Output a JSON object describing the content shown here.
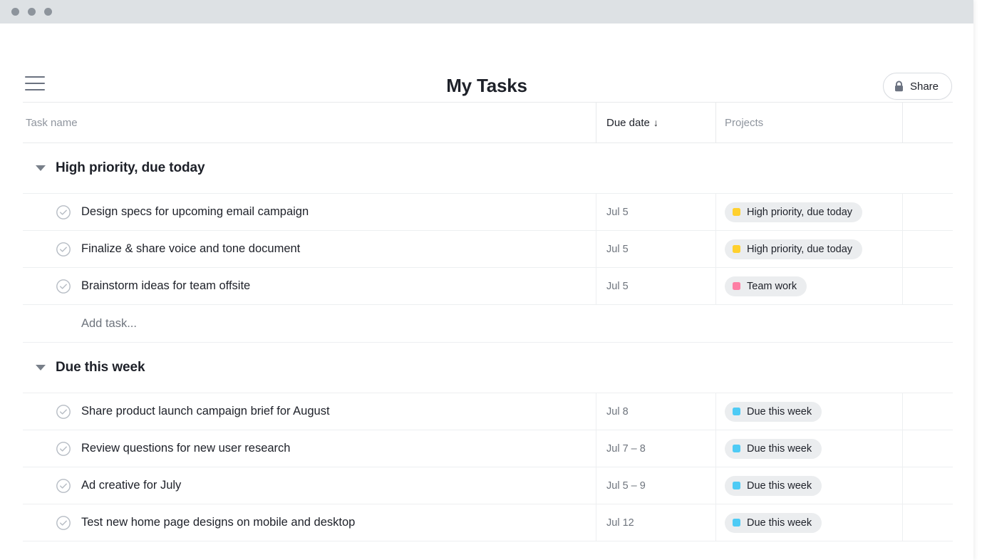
{
  "window": {
    "traffic_lights": [
      "close",
      "minimize",
      "maximize"
    ]
  },
  "header": {
    "menu_icon": "hamburger-icon",
    "title": "My Tasks",
    "share": {
      "label": "Share",
      "icon": "lock-icon"
    }
  },
  "table": {
    "columns": [
      {
        "label": "Task name",
        "sorted": false,
        "sort_arrow": ""
      },
      {
        "label": "Due date",
        "sorted": true,
        "sort_arrow": "↓"
      },
      {
        "label": "Projects",
        "sorted": false,
        "sort_arrow": ""
      },
      {
        "label": "",
        "sorted": false,
        "sort_arrow": ""
      }
    ],
    "add_task_label": "Add task...",
    "sections": [
      {
        "title": "High priority, due today",
        "expanded": true,
        "caret_icon": "caret-down-icon",
        "has_add_task": true,
        "tasks": [
          {
            "name": "Design specs for upcoming email campaign",
            "due": "Jul 5",
            "project": "High priority, due today",
            "project_color": "#ffd02e",
            "check_icon": "check-circle-icon"
          },
          {
            "name": "Finalize & share voice and tone document",
            "due": "Jul 5",
            "project": "High priority, due today",
            "project_color": "#ffd02e",
            "check_icon": "check-circle-icon"
          },
          {
            "name": "Brainstorm ideas for team offsite",
            "due": "Jul 5",
            "project": "Team work",
            "project_color": "#fd7fa4",
            "check_icon": "check-circle-icon"
          }
        ]
      },
      {
        "title": "Due this week",
        "expanded": true,
        "caret_icon": "caret-down-icon",
        "has_add_task": false,
        "tasks": [
          {
            "name": "Share product launch campaign brief for August",
            "due": "Jul 8",
            "project": "Due this week",
            "project_color": "#4ecbf5",
            "check_icon": "check-circle-icon"
          },
          {
            "name": "Review questions for new user research",
            "due": "Jul 7 – 8",
            "project": "Due this week",
            "project_color": "#4ecbf5",
            "check_icon": "check-circle-icon"
          },
          {
            "name": "Ad creative for July",
            "due": "Jul 5 – 9",
            "project": "Due this week",
            "project_color": "#4ecbf5",
            "check_icon": "check-circle-icon"
          },
          {
            "name": "Test new home page designs on mobile and desktop",
            "due": "Jul 12",
            "project": "Due this week",
            "project_color": "#4ecbf5",
            "check_icon": "check-circle-icon"
          }
        ]
      }
    ]
  },
  "colors": {
    "titlebar": "#dde1e4",
    "text_primary": "#1e2129",
    "text_muted": "#8f959e",
    "pill_bg": "#ebedef",
    "border": "#edeff1"
  }
}
